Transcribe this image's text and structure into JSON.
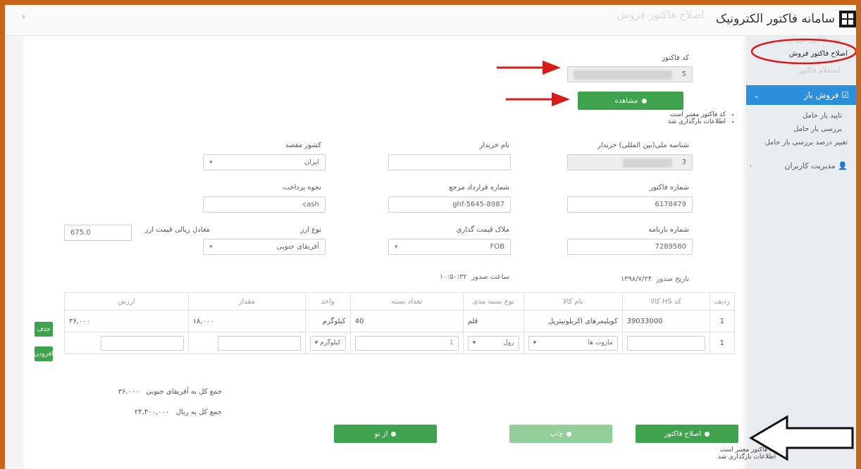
{
  "header": {
    "app_title": "سامانه فاکتور الکترونیک",
    "ghost_title": "اصلاح فاکتور فروش"
  },
  "sidebar": {
    "ghost_item": "ثبت فاکتور فروش",
    "active_item": "اصلاح فاکتور فروش",
    "ghost_item2": "استعلام فاکتور",
    "section_label": "فروش بار",
    "sub_items": [
      "تایید بار حامل",
      "بررسی بار حامل",
      "تغییر درصد بررسی بار حامل"
    ],
    "users_label": "مدیریت کاربران"
  },
  "form": {
    "invoice_code_label": "کد فاکتور",
    "invoice_code_value": "5",
    "view_button": "مشاهده",
    "messages": [
      "کد فاکتور معتبر است",
      "اطلاعات بارگذاری شد"
    ],
    "buyer_id_label": "شناسه ملی(بین المللی) خریدار",
    "buyer_id_value": "3",
    "buyer_name_label": "نام خریدار",
    "buyer_name_value": "",
    "dest_country_label": "کشور مقصد",
    "dest_country_value": "ایران",
    "invoice_number_label": "شماره فاکتور",
    "invoice_number_value": "6178479",
    "contract_label": "شماره قرارداد مرجع",
    "contract_value": "ghf-5645-8987",
    "payment_label": "نحوه پرداخت",
    "payment_value": "cash",
    "bill_label": "شماره بارنامه",
    "bill_value": "7289580",
    "pricing_label": "ملاک قیمت گذاری",
    "pricing_value": "FOB",
    "currency_label": "نوع ارز",
    "currency_value": "آفریقای جنوبی",
    "rate_label": "معادل ریالی قیمت ارز",
    "rate_value": "675.0",
    "issue_date_label": "تاریخ صدور",
    "issue_date_value": "۱۳۹۸/۷/۲۴",
    "issue_time_label": "ساعت صدور",
    "issue_time_value": "۱۰:۵۰:۳۲"
  },
  "table": {
    "headers": [
      "ردیف",
      "کد HS کالا",
      "نام کالا",
      "نوع بسته بندی",
      "تعداد بسته",
      "واحد",
      "مقدار",
      "ارزش"
    ],
    "row1": {
      "index": "1",
      "hs": "39033000",
      "name": "کوپلیمرهای اکریلونیتریل",
      "package": "قلم",
      "count": "40",
      "unit": "کیلوگرم",
      "amount": "۱۸,۰۰۰",
      "value": "۳۶,۰۰۰",
      "delete": "حذف"
    },
    "row2": {
      "index": "1",
      "name_select": "مازوت ها",
      "package_select": "رول",
      "count_value": "1",
      "unit_select": "کیلوگرم",
      "add": "افزودن"
    }
  },
  "totals": {
    "foreign_label": "جمع کل به آفریقای جنوبی",
    "foreign_value": "۳۶,۰۰۰",
    "rial_label": "جمع کل به ریال",
    "rial_value": "۲۴,۳۰۰,۰۰۰"
  },
  "actions": {
    "edit": "اصلاح فاکتور",
    "print": "چاپ",
    "new": "از نو"
  },
  "footer_messages": [
    "کد فاکتور معتبر است",
    "اطلاعات بارگذاری شد"
  ],
  "colors": {
    "frame": "#c8651b",
    "button_green": "#3fa34d",
    "sidebar_blue": "#2c8fdb",
    "arrow_red": "#d81c1c"
  }
}
